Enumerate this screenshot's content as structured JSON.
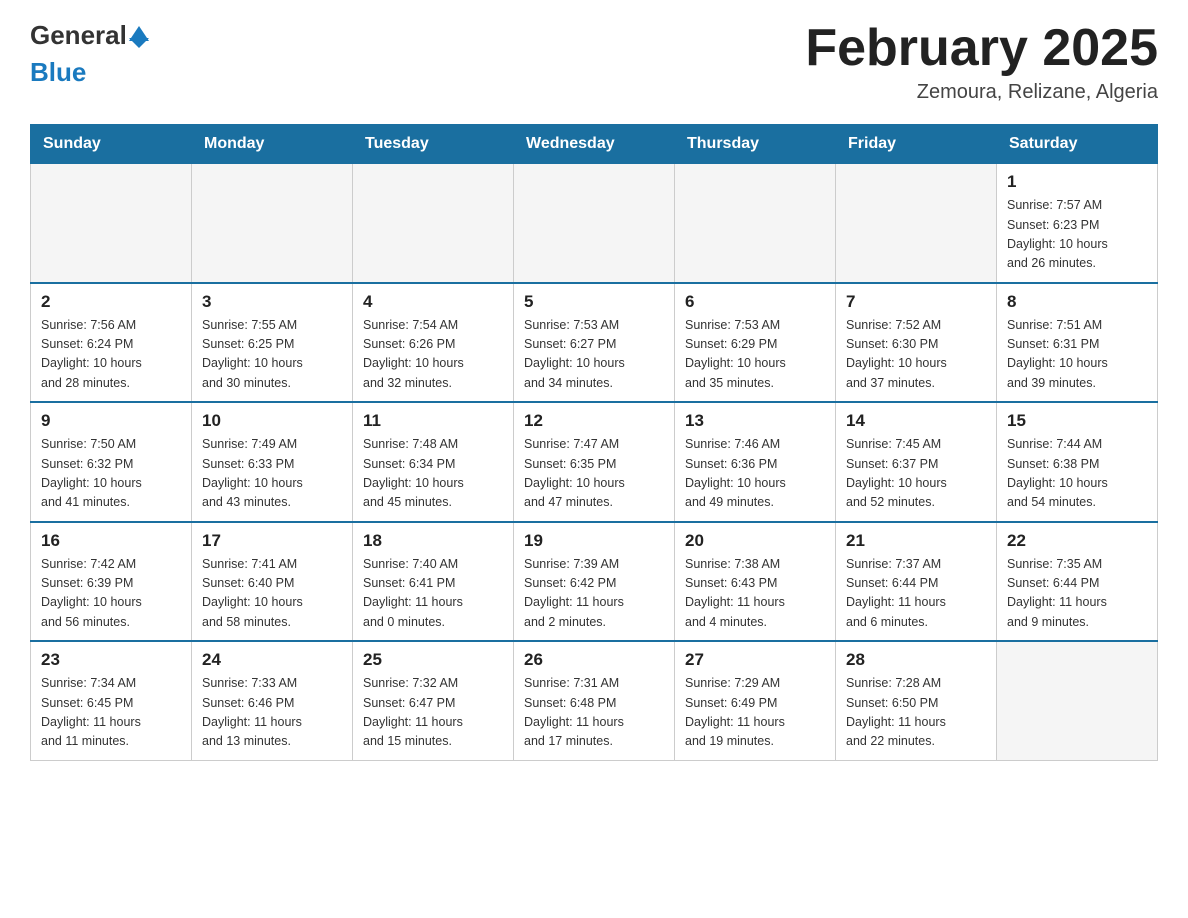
{
  "header": {
    "logo_general": "General",
    "logo_blue": "Blue",
    "title": "February 2025",
    "subtitle": "Zemoura, Relizane, Algeria"
  },
  "days_of_week": [
    "Sunday",
    "Monday",
    "Tuesday",
    "Wednesday",
    "Thursday",
    "Friday",
    "Saturday"
  ],
  "weeks": [
    [
      {
        "day": "",
        "info": ""
      },
      {
        "day": "",
        "info": ""
      },
      {
        "day": "",
        "info": ""
      },
      {
        "day": "",
        "info": ""
      },
      {
        "day": "",
        "info": ""
      },
      {
        "day": "",
        "info": ""
      },
      {
        "day": "1",
        "info": "Sunrise: 7:57 AM\nSunset: 6:23 PM\nDaylight: 10 hours\nand 26 minutes."
      }
    ],
    [
      {
        "day": "2",
        "info": "Sunrise: 7:56 AM\nSunset: 6:24 PM\nDaylight: 10 hours\nand 28 minutes."
      },
      {
        "day": "3",
        "info": "Sunrise: 7:55 AM\nSunset: 6:25 PM\nDaylight: 10 hours\nand 30 minutes."
      },
      {
        "day": "4",
        "info": "Sunrise: 7:54 AM\nSunset: 6:26 PM\nDaylight: 10 hours\nand 32 minutes."
      },
      {
        "day": "5",
        "info": "Sunrise: 7:53 AM\nSunset: 6:27 PM\nDaylight: 10 hours\nand 34 minutes."
      },
      {
        "day": "6",
        "info": "Sunrise: 7:53 AM\nSunset: 6:29 PM\nDaylight: 10 hours\nand 35 minutes."
      },
      {
        "day": "7",
        "info": "Sunrise: 7:52 AM\nSunset: 6:30 PM\nDaylight: 10 hours\nand 37 minutes."
      },
      {
        "day": "8",
        "info": "Sunrise: 7:51 AM\nSunset: 6:31 PM\nDaylight: 10 hours\nand 39 minutes."
      }
    ],
    [
      {
        "day": "9",
        "info": "Sunrise: 7:50 AM\nSunset: 6:32 PM\nDaylight: 10 hours\nand 41 minutes."
      },
      {
        "day": "10",
        "info": "Sunrise: 7:49 AM\nSunset: 6:33 PM\nDaylight: 10 hours\nand 43 minutes."
      },
      {
        "day": "11",
        "info": "Sunrise: 7:48 AM\nSunset: 6:34 PM\nDaylight: 10 hours\nand 45 minutes."
      },
      {
        "day": "12",
        "info": "Sunrise: 7:47 AM\nSunset: 6:35 PM\nDaylight: 10 hours\nand 47 minutes."
      },
      {
        "day": "13",
        "info": "Sunrise: 7:46 AM\nSunset: 6:36 PM\nDaylight: 10 hours\nand 49 minutes."
      },
      {
        "day": "14",
        "info": "Sunrise: 7:45 AM\nSunset: 6:37 PM\nDaylight: 10 hours\nand 52 minutes."
      },
      {
        "day": "15",
        "info": "Sunrise: 7:44 AM\nSunset: 6:38 PM\nDaylight: 10 hours\nand 54 minutes."
      }
    ],
    [
      {
        "day": "16",
        "info": "Sunrise: 7:42 AM\nSunset: 6:39 PM\nDaylight: 10 hours\nand 56 minutes."
      },
      {
        "day": "17",
        "info": "Sunrise: 7:41 AM\nSunset: 6:40 PM\nDaylight: 10 hours\nand 58 minutes."
      },
      {
        "day": "18",
        "info": "Sunrise: 7:40 AM\nSunset: 6:41 PM\nDaylight: 11 hours\nand 0 minutes."
      },
      {
        "day": "19",
        "info": "Sunrise: 7:39 AM\nSunset: 6:42 PM\nDaylight: 11 hours\nand 2 minutes."
      },
      {
        "day": "20",
        "info": "Sunrise: 7:38 AM\nSunset: 6:43 PM\nDaylight: 11 hours\nand 4 minutes."
      },
      {
        "day": "21",
        "info": "Sunrise: 7:37 AM\nSunset: 6:44 PM\nDaylight: 11 hours\nand 6 minutes."
      },
      {
        "day": "22",
        "info": "Sunrise: 7:35 AM\nSunset: 6:44 PM\nDaylight: 11 hours\nand 9 minutes."
      }
    ],
    [
      {
        "day": "23",
        "info": "Sunrise: 7:34 AM\nSunset: 6:45 PM\nDaylight: 11 hours\nand 11 minutes."
      },
      {
        "day": "24",
        "info": "Sunrise: 7:33 AM\nSunset: 6:46 PM\nDaylight: 11 hours\nand 13 minutes."
      },
      {
        "day": "25",
        "info": "Sunrise: 7:32 AM\nSunset: 6:47 PM\nDaylight: 11 hours\nand 15 minutes."
      },
      {
        "day": "26",
        "info": "Sunrise: 7:31 AM\nSunset: 6:48 PM\nDaylight: 11 hours\nand 17 minutes."
      },
      {
        "day": "27",
        "info": "Sunrise: 7:29 AM\nSunset: 6:49 PM\nDaylight: 11 hours\nand 19 minutes."
      },
      {
        "day": "28",
        "info": "Sunrise: 7:28 AM\nSunset: 6:50 PM\nDaylight: 11 hours\nand 22 minutes."
      },
      {
        "day": "",
        "info": ""
      }
    ]
  ]
}
